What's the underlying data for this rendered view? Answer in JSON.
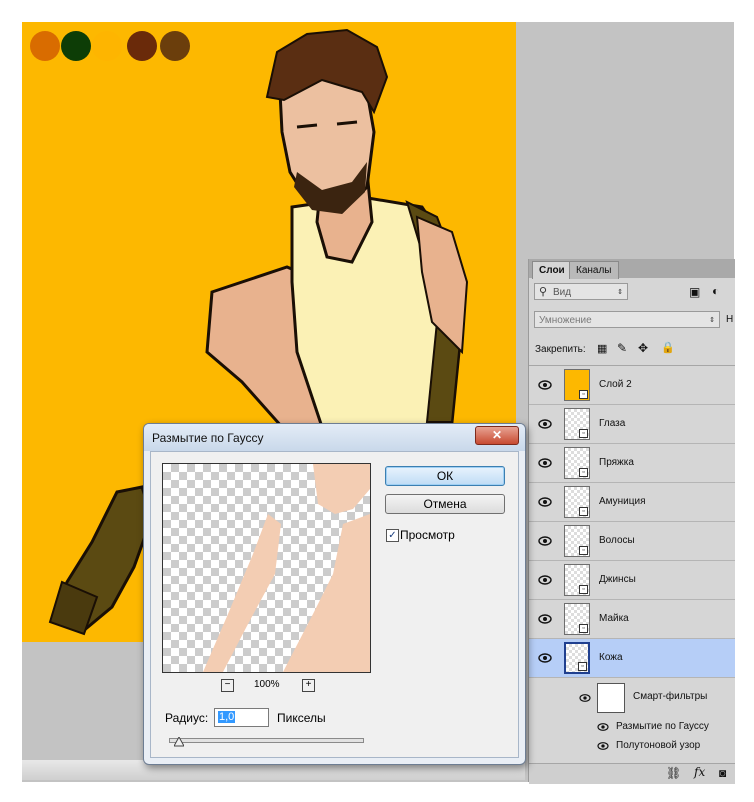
{
  "canvas": {
    "background_color": "#fdb800",
    "palette": [
      "#d96c00",
      "#0d3d06",
      "#feb500",
      "#6a2a0a",
      "#6b3e0c"
    ]
  },
  "layers_panel": {
    "tabs": [
      "Слои",
      "Каналы"
    ],
    "filter_placeholder": "Вид",
    "blend_mode": "Умножение",
    "opacity_cut_label": "Н",
    "lock_label": "Закрепить:",
    "layers": [
      {
        "name": "Слой 2",
        "selected": false
      },
      {
        "name": "Глаза",
        "selected": false
      },
      {
        "name": "Пряжка",
        "selected": false
      },
      {
        "name": "Амуниция",
        "selected": false
      },
      {
        "name": "Волосы",
        "selected": false
      },
      {
        "name": "Джинсы",
        "selected": false
      },
      {
        "name": "Майка",
        "selected": false
      },
      {
        "name": "Кожа",
        "selected": true
      }
    ],
    "smart_filters_label": "Смарт-фильтры",
    "filters": [
      "Размытие по Гауссу",
      "Полутоновой узор"
    ]
  },
  "dialog": {
    "title": "Размытие по Гауссу",
    "ok_label": "ОК",
    "cancel_label": "Отмена",
    "preview_label": "Просмотр",
    "preview_checked": true,
    "zoom_value": "100%",
    "radius_label": "Радиус:",
    "radius_value": "1,0",
    "radius_unit": "Пикселы",
    "slider_level_fraction": 0.05
  }
}
